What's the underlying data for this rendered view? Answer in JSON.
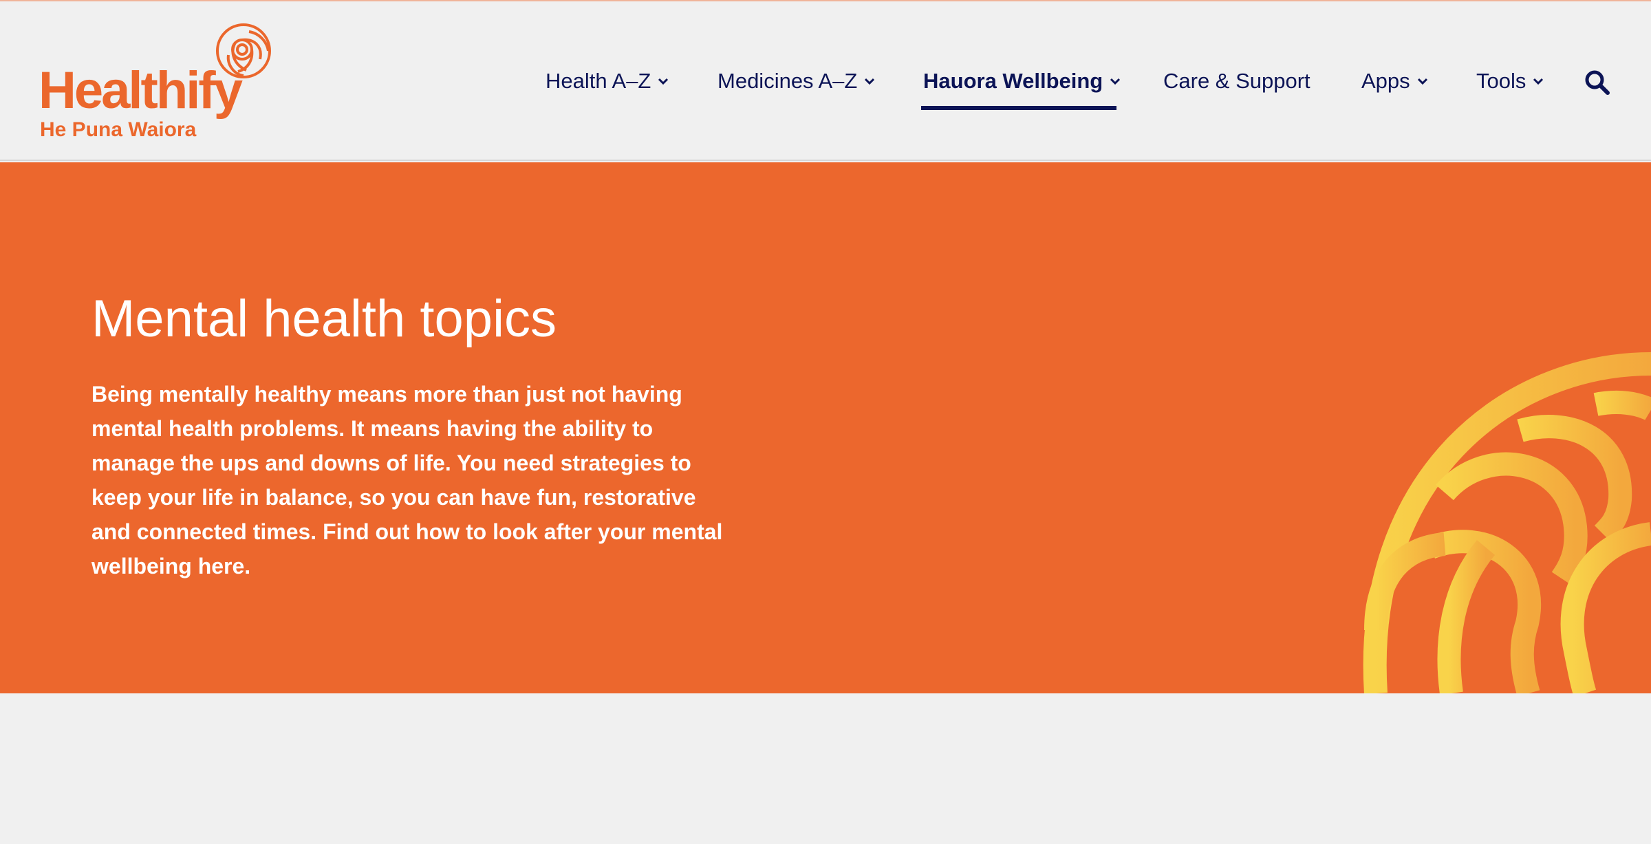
{
  "brand": {
    "name": "Healthify",
    "tagline": "He Puna Waiora",
    "color": "#eb672c"
  },
  "nav": {
    "items": [
      {
        "label": "Health A–Z",
        "has_dropdown": true,
        "active": false
      },
      {
        "label": "Medicines A–Z",
        "has_dropdown": true,
        "active": false
      },
      {
        "label": "Hauora Wellbeing",
        "has_dropdown": true,
        "active": true
      },
      {
        "label": "Care & Support",
        "has_dropdown": false,
        "active": false
      },
      {
        "label": "Apps",
        "has_dropdown": true,
        "active": false
      },
      {
        "label": "Tools",
        "has_dropdown": true,
        "active": false
      }
    ],
    "search_icon": "search-icon",
    "text_color": "#0c1456"
  },
  "hero": {
    "title": "Mental health topics",
    "intro": "Being mentally healthy means more than just not having mental health problems. It means having the ability to manage the ups and downs of life. You need strategies to keep your life in balance, so you can have fun, restorative and connected times. Find out how to look after your mental wellbeing here.",
    "background_color": "#ec672d",
    "graphic_color": "#f8cf47"
  }
}
